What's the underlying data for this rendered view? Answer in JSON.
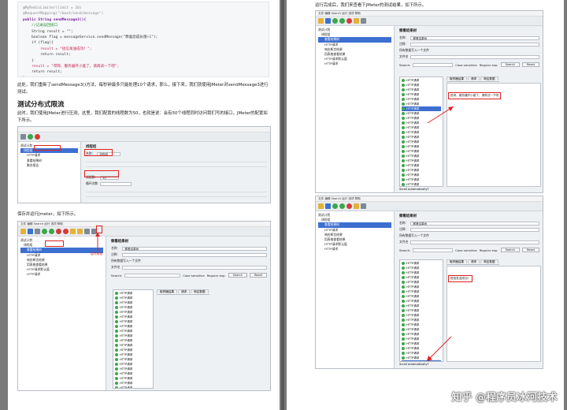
{
  "left_page": {
    "code_lines": [
      {
        "t": "@MyRedisLimiter(limit = 10)",
        "c": "ann"
      },
      {
        "t": "@RequestMapping(\"/boot/send/message\")",
        "c": "ann"
      },
      {
        "t": "public String sendMessage3(){",
        "c": "kw"
      },
      {
        "t": "    //记录返回接口",
        "c": "cmt"
      },
      {
        "t": "    String result = \"\";",
        "c": ""
      },
      {
        "t": "    boolean flag = messageService.sendMessage(\"恭喜您成长值+1\");",
        "c": ""
      },
      {
        "t": "    if (flag){",
        "c": ""
      },
      {
        "t": "        result = \"短信发送成功！\";",
        "c": "str"
      },
      {
        "t": "        return result;",
        "c": ""
      },
      {
        "t": "    }",
        "c": ""
      },
      {
        "t": "    result = \"哎呀，服务器开小差了，请再试一下吧\";",
        "c": "str"
      },
      {
        "t": "    return result;",
        "c": ""
      },
      {
        "t": "}",
        "c": ""
      }
    ],
    "para1": "此处，我们重新了sendMessage3()方法，每秒钟最多只能处理10个请求，那么，接下来，我们就使用JMeter对sendMessage3进行测试。",
    "heading": "测试分布式限流",
    "para2": "此时，我们使用JMeter进行压测，这里，我们配置的线程数为50，也就是说：会有50个线程同时访问我们写的接口，JMeter的配置如下所示。",
    "para3": "保存并运行Jmeter，如下所示。",
    "jm1": {
      "tree": [
        "测试计划",
        "线程组",
        "HTTP请求",
        "查看结果树",
        "聚合报告"
      ],
      "panel_title": "线程组",
      "name_label": "名称：",
      "name_value": "线程组",
      "threads_label": "线程数：",
      "threads_value": "50",
      "loop_label": "循环次数"
    },
    "jm2": {
      "menu": "文件 编辑 Search 运行 选项 帮助",
      "tree": [
        "测试计划",
        "线程组",
        "查看结果树",
        "HTTP请求",
        "响应断言结果",
        "用表格查看结果",
        "HTTP请求默认值",
        "HTTP请求"
      ],
      "panel_title": "察看结果树",
      "name_label": "名称：",
      "name_value": "察看结果树",
      "comment_label": "注释：",
      "file_label": "所有数据写入一个文件",
      "filename_label": "文件名",
      "search_label": "Search:",
      "case_label": "Case sensitive",
      "regex_label": "Regular exp.",
      "search_btn": "Search",
      "reset_btn": "Reset",
      "text_label": "Text",
      "tab_sampler": "取样器结果",
      "tab_request": "请求",
      "tab_response": "响应数据",
      "result_item": "HTTP请求",
      "save_note": "运行按钮"
    }
  },
  "right_page": {
    "intro": "运行完成后，我们来查看下JMeter的测试结果，如下所示。",
    "jm3": {
      "menu": "文件 编辑 Search 运行 选项 帮助",
      "tree": [
        "测试计划",
        "线程组",
        "查看结果树",
        "HTTP请求",
        "响应断言结果",
        "用表格查看结果",
        "HTTP请求默认值",
        "HTTP请求"
      ],
      "panel_title": "察看结果树",
      "name_label": "名称：",
      "name_value": "察看结果树",
      "comment_label": "注释：",
      "file_label": "所有数据写入一个文件",
      "filename_label": "文件名",
      "search_label": "Search:",
      "case_label": "Case sensitive",
      "regex_label": "Regular exp.",
      "search_btn": "Search",
      "reset_btn": "Reset",
      "text_label": "Text",
      "tab_sampler": "取样器结果",
      "tab_request": "请求",
      "tab_response": "响应数据",
      "response": "哎呀，服务器开小差了，请再试一下吧",
      "result_item": "HTTP请求",
      "scroll_label": "Scroll automatically?"
    },
    "jm4": {
      "menu": "文件 编辑 Search 运行 选项 帮助",
      "tree": [
        "测试计划",
        "线程组",
        "查看结果树",
        "HTTP请求",
        "响应断言结果",
        "用表格查看结果",
        "HTTP请求默认值",
        "HTTP请求"
      ],
      "panel_title": "察看结果树",
      "name_label": "名称：",
      "name_value": "察看结果树",
      "comment_label": "注释：",
      "file_label": "所有数据写入一个文件",
      "filename_label": "文件名",
      "search_label": "Search:",
      "case_label": "Case sensitive",
      "regex_label": "Regular exp.",
      "search_btn": "Search",
      "reset_btn": "Reset",
      "text_label": "Text",
      "tab_sampler": "取样器结果",
      "tab_request": "请求",
      "tab_response": "响应数据",
      "response": "短信发送成功！",
      "result_item": "HTTP请求",
      "scroll_label": "Scroll automatically?"
    }
  },
  "watermark": "知乎 @程序员冰河技术"
}
